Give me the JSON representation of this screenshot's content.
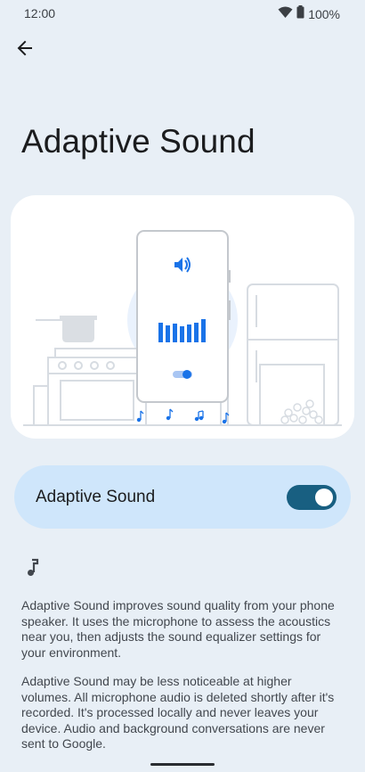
{
  "status_bar": {
    "time": "12:00",
    "battery": "100%"
  },
  "header": {
    "back_icon": "arrow-back-icon",
    "title": "Adaptive Sound"
  },
  "illustration": {
    "icons": [
      "volume-icon",
      "equalizer-icon",
      "toggle-icon",
      "music-note-icon"
    ]
  },
  "setting": {
    "label": "Adaptive Sound",
    "enabled": true
  },
  "info": {
    "icon": "music-note-icon",
    "paragraph1": "Adaptive Sound improves sound quality from your phone speaker. It uses the microphone to assess the acoustics near you, then adjusts the sound equalizer settings for your environment.",
    "paragraph2": "Adaptive Sound may be less noticeable at higher volumes. All microphone audio is deleted shortly after it's recorded. It's processed locally and never leaves your device. Audio and background conversations are never sent to Google."
  },
  "colors": {
    "background": "#e8eff6",
    "card": "#ffffff",
    "toggle_card": "#cfe6fb",
    "switch_on": "#185f81",
    "accent": "#1a73e8"
  }
}
